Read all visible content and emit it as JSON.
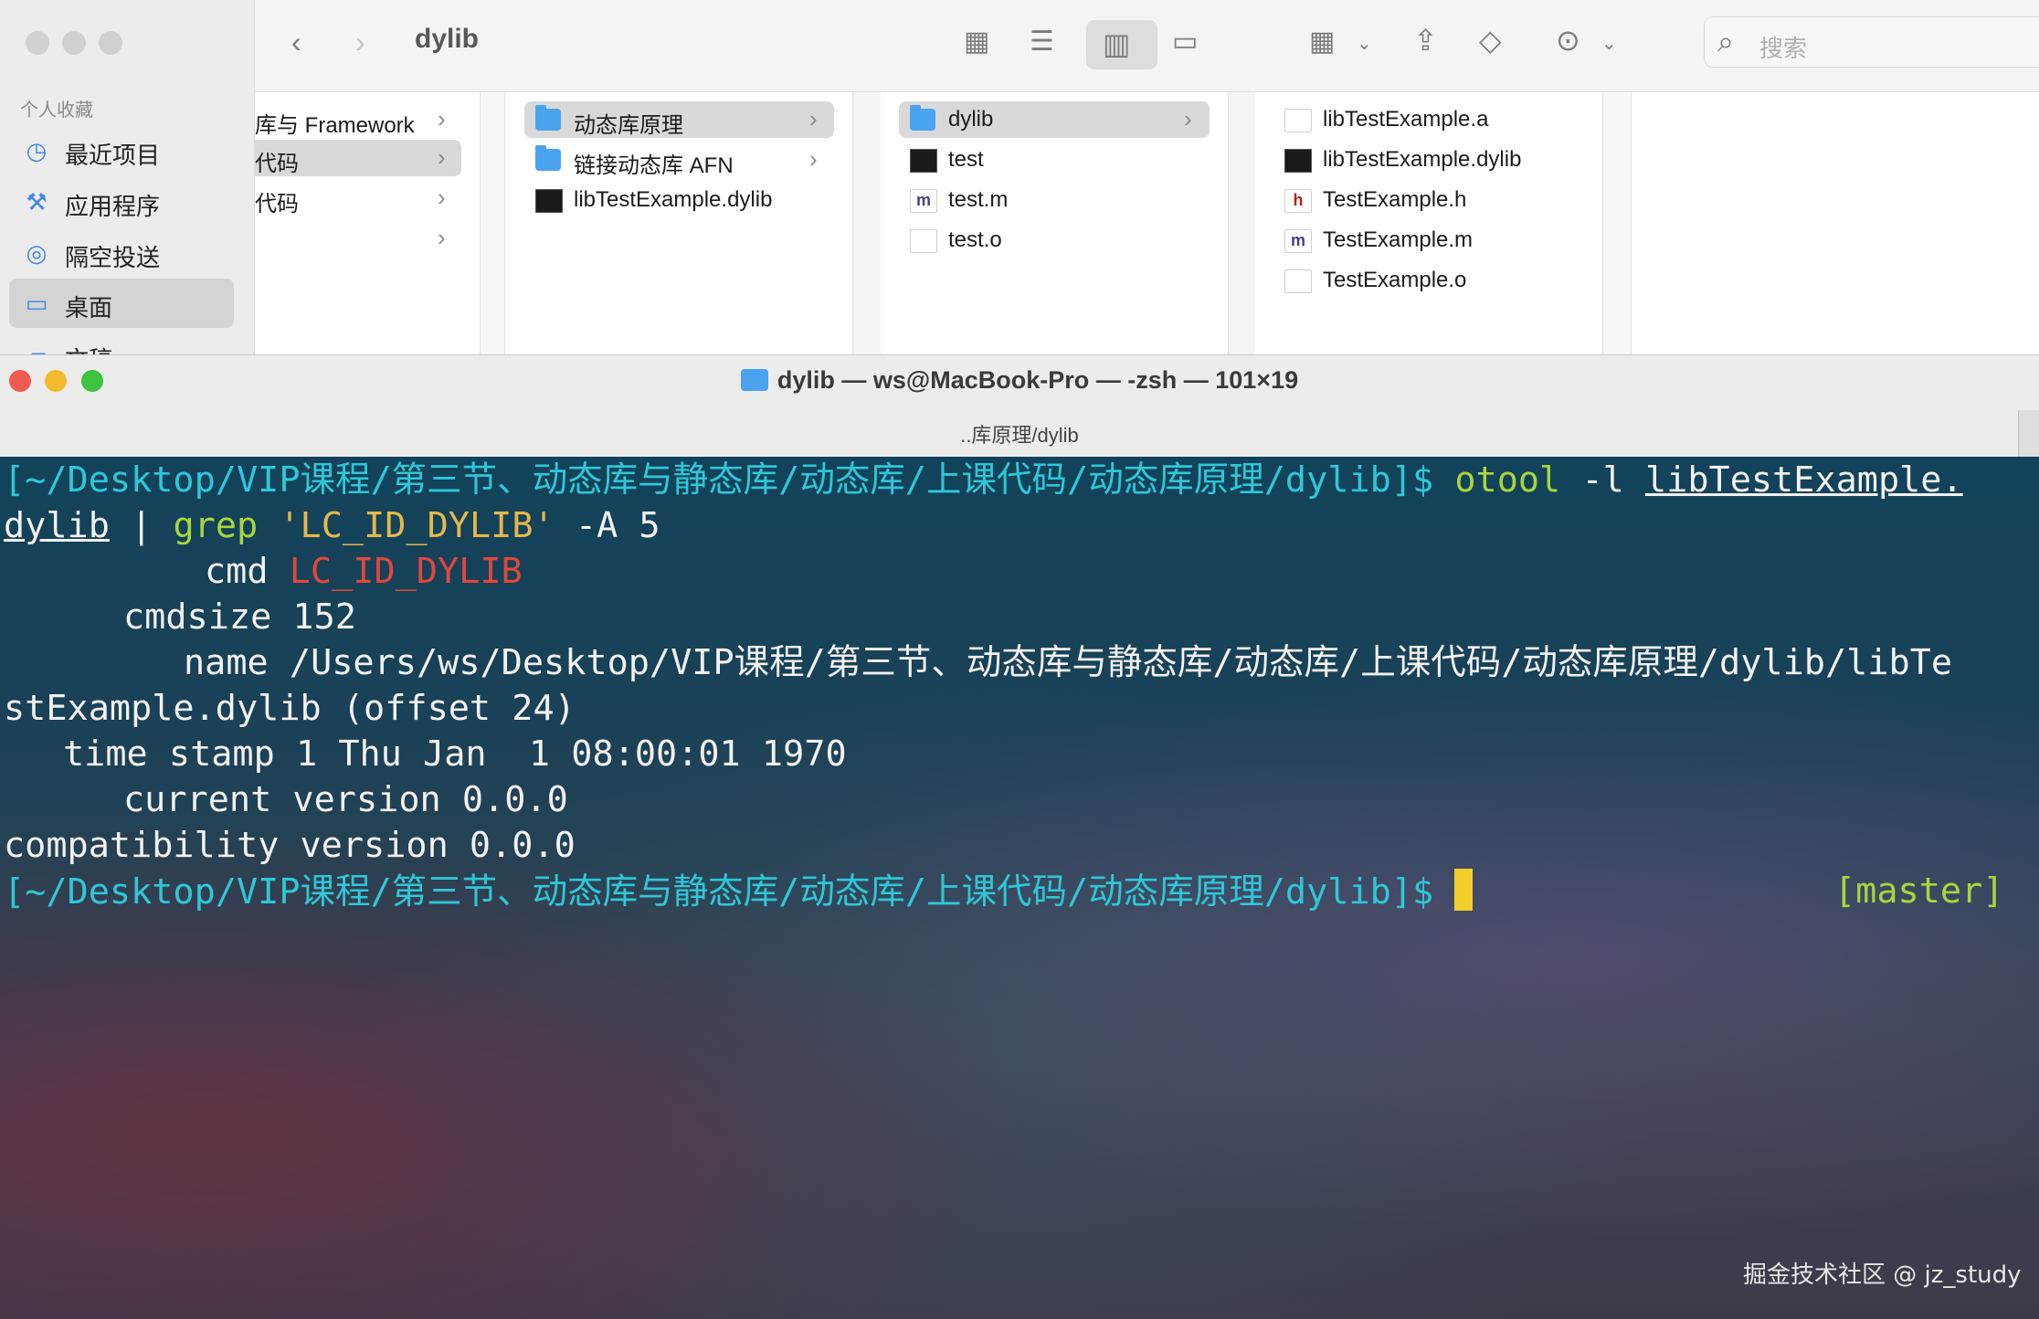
{
  "finder": {
    "title": "dylib",
    "sidebar": {
      "section": "个人收藏",
      "items": [
        {
          "icon": "clock-icon",
          "label": "最近项目"
        },
        {
          "icon": "applications-icon",
          "label": "应用程序"
        },
        {
          "icon": "airdrop-icon",
          "label": "隔空投送"
        },
        {
          "icon": "desktop-icon",
          "label": "桌面"
        },
        {
          "icon": "document-icon",
          "label": "文稿"
        }
      ]
    },
    "search_placeholder": "搜索",
    "columns": [
      {
        "rows": [
          {
            "label": "库与 Framework",
            "kind": "chevron"
          },
          {
            "label": "代码",
            "kind": "chevron",
            "selected": true
          },
          {
            "label": "代码",
            "kind": "chevron"
          },
          {
            "label": "",
            "kind": "chevron"
          }
        ]
      },
      {
        "rows": [
          {
            "label": "动态库原理",
            "kind": "folder",
            "chevron": true,
            "selected": true
          },
          {
            "label": "链接动态库 AFN",
            "kind": "folder",
            "chevron": true
          },
          {
            "label": "libTestExample.dylib",
            "kind": "exec"
          }
        ]
      },
      {
        "rows": [
          {
            "label": "dylib",
            "kind": "folder",
            "chevron": true,
            "selected": true
          },
          {
            "label": "test",
            "kind": "exec"
          },
          {
            "label": "test.m",
            "kind": "src",
            "badge": "m"
          },
          {
            "label": "test.o",
            "kind": "doc"
          }
        ]
      },
      {
        "rows": [
          {
            "label": "libTestExample.a",
            "kind": "doc"
          },
          {
            "label": "libTestExample.dylib",
            "kind": "exec"
          },
          {
            "label": "TestExample.h",
            "kind": "src",
            "badge": "h"
          },
          {
            "label": "TestExample.m",
            "kind": "src",
            "badge": "m"
          },
          {
            "label": "TestExample.o",
            "kind": "doc"
          }
        ]
      }
    ]
  },
  "terminal": {
    "title": "dylib — ws@MacBook-Pro — -zsh — 101×19",
    "tab": "..库原理/dylib",
    "prompt": "[~/Desktop/VIP课程/第三节、动态库与静态库/动态库/上课代码/动态库原理/dylib]$",
    "cmd_name": "otool",
    "cmd_flag": "-l",
    "cmd_file_a": "libTestExample.",
    "cmd_file_b": "dylib",
    "pipe": "|",
    "grep": "grep",
    "grep_arg": "'LC_ID_DYLIB'",
    "grep_flag": "-A 5",
    "out_cmd_key": "cmd",
    "out_cmd_val": "LC_ID_DYLIB",
    "out_cmdsize": "cmdsize 152",
    "out_name_a": "name /Users/ws/Desktop/VIP课程/第三节、动态库与静态库/动态库/上课代码/动态库原理/dylib/libTe",
    "out_name_b": "stExample.dylib (offset 24)",
    "out_timestamp": "time stamp 1 Thu Jan  1 08:00:01 1970",
    "out_current": "current version 0.0.0",
    "out_compat": "compatibility version 0.0.0",
    "branch": "[master]"
  },
  "watermark": "掘金技术社区 @ jz_study",
  "colors": {
    "prompt": "#2fc7d6",
    "command": "#a9d63b",
    "string": "#e5b84a",
    "error": "#e2463c",
    "cursor": "#f2cf2a"
  }
}
